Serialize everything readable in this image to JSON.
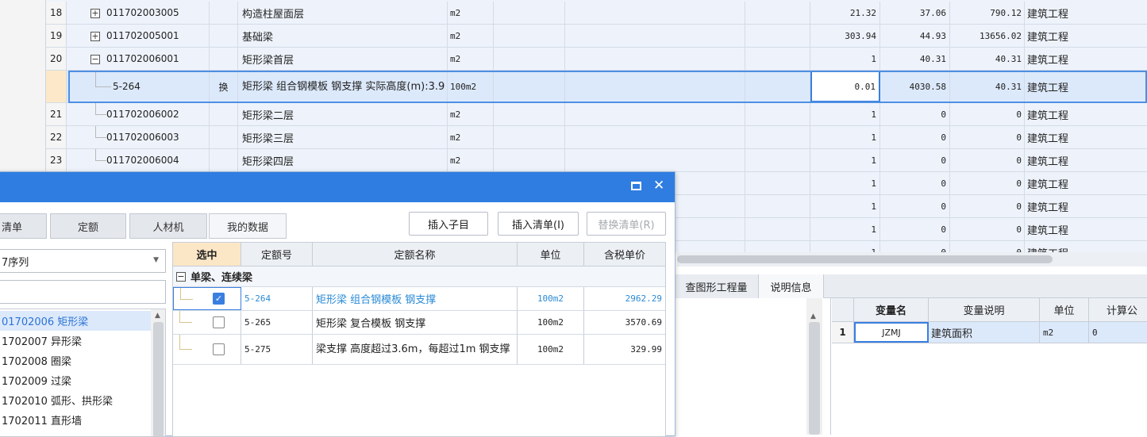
{
  "grid": {
    "rows": [
      {
        "no": "18",
        "code": "011702003005",
        "expand": "+",
        "mark": "",
        "name": "构造柱屋面层",
        "unit": "m2",
        "qty": "21.32",
        "price": "37.06",
        "total": "790.12",
        "type": "建筑工程"
      },
      {
        "no": "19",
        "code": "011702005001",
        "expand": "+",
        "mark": "",
        "name": "基础梁",
        "unit": "m2",
        "qty": "303.94",
        "price": "44.93",
        "total": "13656.02",
        "type": "建筑工程"
      },
      {
        "no": "20",
        "code": "011702006001",
        "expand": "−",
        "mark": "",
        "name": "矩形梁首层",
        "unit": "m2",
        "qty": "1",
        "price": "40.31",
        "total": "40.31",
        "type": "建筑工程"
      },
      {
        "no": "",
        "code": "5-264",
        "expand": "",
        "mark": "换",
        "name": "矩形梁 组合钢模板 钢支撑  实际高度(m):3.9",
        "unit": "100m2",
        "qty": "0.01",
        "price": "4030.58",
        "total": "40.31",
        "type": "建筑工程"
      },
      {
        "no": "21",
        "code": "011702006002",
        "expand": "",
        "mark": "",
        "name": "矩形梁二层",
        "unit": "m2",
        "qty": "1",
        "price": "0",
        "total": "0",
        "type": "建筑工程"
      },
      {
        "no": "22",
        "code": "011702006003",
        "expand": "",
        "mark": "",
        "name": "矩形梁三层",
        "unit": "m2",
        "qty": "1",
        "price": "0",
        "total": "0",
        "type": "建筑工程"
      },
      {
        "no": "23",
        "code": "011702006004",
        "expand": "",
        "mark": "",
        "name": "矩形梁四层",
        "unit": "m2",
        "qty": "1",
        "price": "0",
        "total": "0",
        "type": "建筑工程"
      },
      {
        "no": "",
        "code": "",
        "expand": "",
        "mark": "",
        "name": "",
        "unit": "",
        "qty": "1",
        "price": "0",
        "total": "0",
        "type": "建筑工程"
      },
      {
        "no": "",
        "code": "",
        "expand": "",
        "mark": "",
        "name": "",
        "unit": "",
        "qty": "1",
        "price": "0",
        "total": "0",
        "type": "建筑工程"
      },
      {
        "no": "",
        "code": "",
        "expand": "",
        "mark": "",
        "name": "",
        "unit": "",
        "qty": "1",
        "price": "0",
        "total": "0",
        "type": "建筑工程"
      },
      {
        "no": "",
        "code": "",
        "expand": "",
        "mark": "",
        "name": "",
        "unit": "",
        "qty": "1",
        "price": "0",
        "total": "0",
        "type": "建筑工程"
      }
    ]
  },
  "bottom": {
    "tabs": [
      "查图形工程量",
      "说明信息"
    ],
    "var_table": {
      "headers": [
        "变量名",
        "变量说明",
        "单位",
        "计算公"
      ],
      "row": {
        "no": "1",
        "name": "JZMJ",
        "desc": "建筑面积",
        "unit": "m2",
        "formula": "0"
      }
    }
  },
  "dialog": {
    "tabs": [
      "清单",
      "定额",
      "人材机",
      "我的数据"
    ],
    "buttons": {
      "insert_child": "插入子目",
      "insert_list": "插入清单(I)",
      "replace_list": "替换清单(R)"
    },
    "combo_value": "7序列",
    "category_list": [
      {
        "label": "01702006 矩形梁",
        "selected": true
      },
      {
        "label": "1702007 异形梁",
        "selected": false
      },
      {
        "label": "1702008 圈梁",
        "selected": false
      },
      {
        "label": "1702009 过梁",
        "selected": false
      },
      {
        "label": "1702010 弧形、拱形梁",
        "selected": false
      },
      {
        "label": "1702011 直形墙",
        "selected": false
      }
    ],
    "quota_table": {
      "headers": [
        "选中",
        "定额号",
        "定额名称",
        "单位",
        "含税单价"
      ],
      "group": "单梁、连续梁",
      "rows": [
        {
          "checked": true,
          "code": "5-264",
          "name": "矩形梁 组合钢模板 钢支撑",
          "unit": "100m2",
          "price": "2962.29"
        },
        {
          "checked": false,
          "code": "5-265",
          "name": "矩形梁 复合模板 钢支撑",
          "unit": "100m2",
          "price": "3570.69"
        },
        {
          "checked": false,
          "code": "5-275",
          "name": "梁支撑 高度超过3.6m，每超过1m 钢支撑",
          "unit": "100m2",
          "price": "329.99"
        }
      ]
    }
  }
}
